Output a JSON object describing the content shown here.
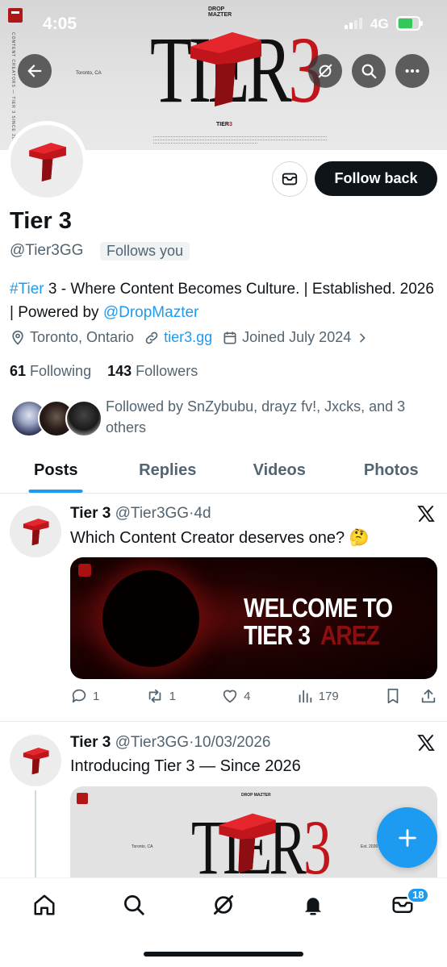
{
  "status_bar": {
    "time": "4:05",
    "network": "4G"
  },
  "banner": {
    "dropmazter_line1": "DROP",
    "dropmazter_line2": "MAZTER",
    "location": "Toronto, CA",
    "title_left": "TIER",
    "title_right": "3",
    "sub_left": "TIER",
    "sub_right": "3",
    "side_text": "CONTENT CREATORS — TIER 3 SINCE 2026"
  },
  "profile": {
    "name": "Tier 3",
    "handle": "@Tier3GG",
    "follows_you": "Follows you",
    "follow_button": "Follow back",
    "bio": {
      "hashtag": "#Tier",
      "part1": " 3 - Where Content Becomes Culture. | Established. 2026 | Powered by ",
      "mention": "@DropMazter"
    },
    "location": "Toronto, Ontario",
    "website": "tier3.gg",
    "joined": "Joined July 2024",
    "following_count": "61",
    "following_label": "Following",
    "followers_count": "143",
    "followers_label": "Followers",
    "followed_by": "Followed by SnZybubu, drayz fv!, Jxcks, and 3 others"
  },
  "tabs": [
    "Posts",
    "Replies",
    "Videos",
    "Photos"
  ],
  "posts": [
    {
      "name": "Tier 3",
      "handle": "@Tier3GG",
      "separator": "·",
      "time": "4d",
      "text": "Which Content Creator deserves one? 🤔",
      "media": {
        "line1": "WELCOME TO",
        "line2": "TIER 3",
        "line2_red": "AREZ"
      },
      "replies": "1",
      "reposts": "1",
      "likes": "4",
      "views": "179"
    },
    {
      "name": "Tier 3",
      "handle": "@Tier3GG",
      "separator": "·",
      "time": "10/03/2026",
      "text": "Introducing Tier 3 — Since 2026",
      "media": {
        "dropmazter": "DROP MAZTER",
        "location": "Toronto, CA",
        "est": "Est. 2026",
        "title_left": "TIER",
        "title_right": "3"
      }
    }
  ],
  "nav": {
    "messages_badge": "18"
  },
  "colors": {
    "accent": "#1d9bf0",
    "brand_red": "#c0151b",
    "text": "#0f1419",
    "muted": "#536471"
  }
}
